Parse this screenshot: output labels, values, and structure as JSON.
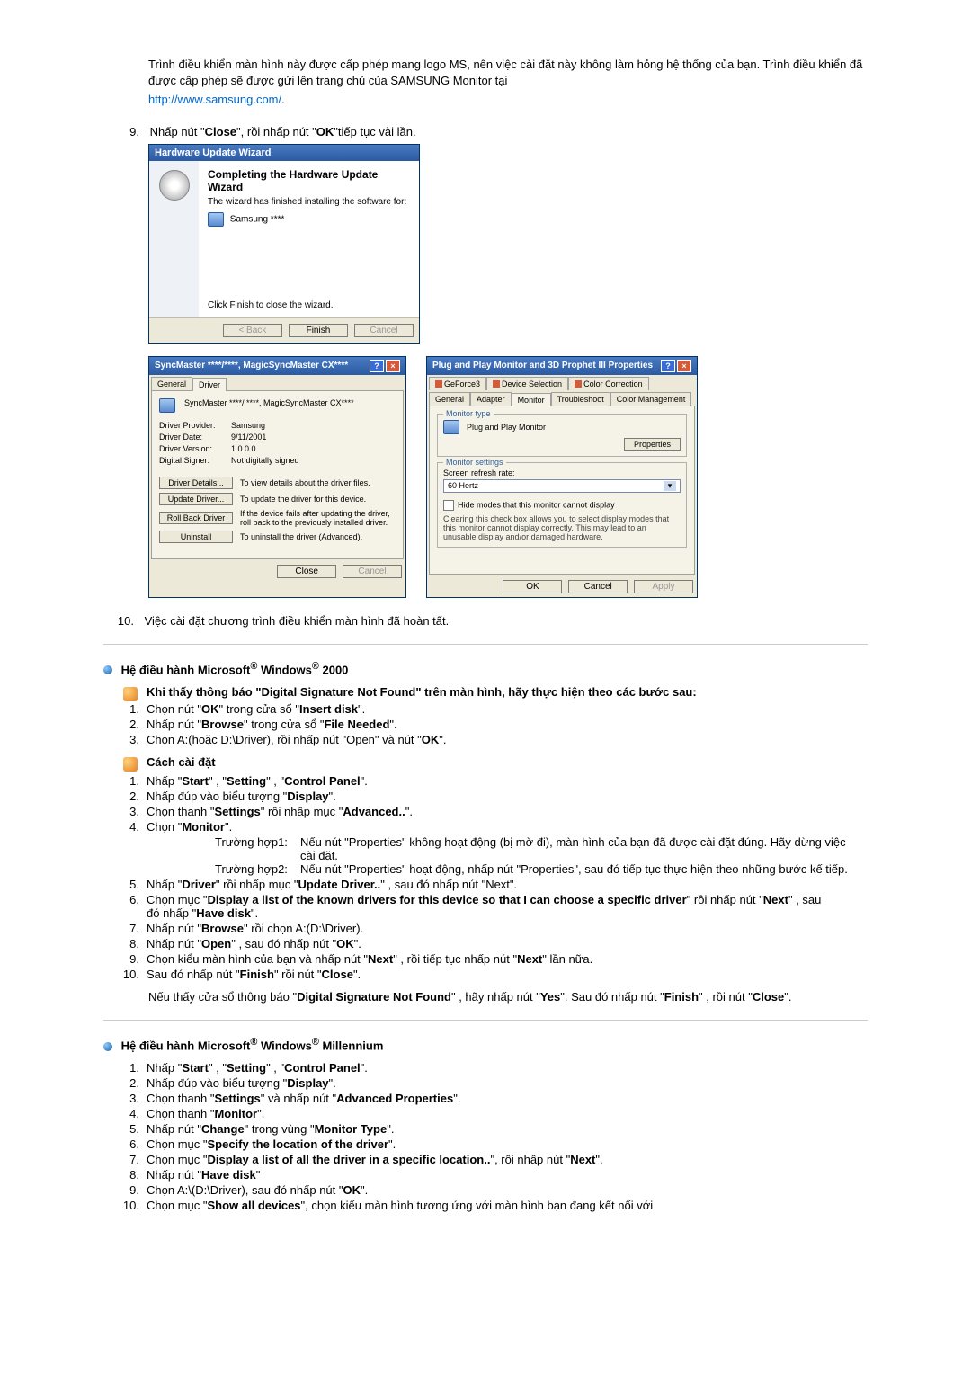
{
  "intro": {
    "p1": "Trình điều khiển màn hình này được cấp phép mang logo MS, nên việc cài đặt này không làm hỏng hệ thống của bạn. Trình điều khiển đã được cấp phép sẽ được gửi lên trang chủ của SAMSUNG Monitor tại",
    "link": "http://www.samsung.com/",
    "link_suffix": "."
  },
  "step9": {
    "num": "9.",
    "text_a": "Nhấp nút \"",
    "close": "Close",
    "text_b": "\", rồi nhấp nút \"",
    "ok": "OK",
    "text_c": "\"tiếp tục vài lần."
  },
  "wizard": {
    "title": "Hardware Update Wizard",
    "heading": "Completing the Hardware Update Wizard",
    "line1": "The wizard has finished installing the software for:",
    "device": "Samsung ****",
    "line2": "Click Finish to close the wizard.",
    "back": "< Back",
    "finish": "Finish",
    "cancel": "Cancel"
  },
  "driverprops": {
    "title": "SyncMaster ****/****, MagicSyncMaster CX****",
    "tab_general": "General",
    "tab_driver": "Driver",
    "device_name": "SyncMaster ****/ ****, MagicSyncMaster CX****",
    "provider_lbl": "Driver Provider:",
    "provider_val": "Samsung",
    "date_lbl": "Driver Date:",
    "date_val": "9/11/2001",
    "ver_lbl": "Driver Version:",
    "ver_val": "1.0.0.0",
    "signer_lbl": "Digital Signer:",
    "signer_val": "Not digitally signed",
    "btn_details": "Driver Details...",
    "desc_details": "To view details about the driver files.",
    "btn_update": "Update Driver...",
    "desc_update": "To update the driver for this device.",
    "btn_rollback": "Roll Back Driver",
    "desc_rollback": "If the device fails after updating the driver, roll back to the previously installed driver.",
    "btn_uninstall": "Uninstall",
    "desc_uninstall": "To uninstall the driver (Advanced).",
    "close": "Close",
    "cancel": "Cancel"
  },
  "dispprops": {
    "title": "Plug and Play Monitor and 3D Prophet III Properties",
    "t_geforce": "GeForce3",
    "t_devsel": "Device Selection",
    "t_colorcorr": "Color Correction",
    "t_general": "General",
    "t_adapter": "Adapter",
    "t_monitor": "Monitor",
    "t_trouble": "Troubleshoot",
    "t_colormgmt": "Color Management",
    "grp_montype": "Monitor type",
    "montype": "Plug and Play Monitor",
    "btn_props": "Properties",
    "grp_monset": "Monitor settings",
    "refresh_lbl": "Screen refresh rate:",
    "refresh_val": "60 Hertz",
    "hide_lbl": "Hide modes that this monitor cannot display",
    "hide_desc": "Clearing this check box allows you to select display modes that this monitor cannot display correctly. This may lead to an unusable display and/or damaged hardware.",
    "ok": "OK",
    "cancel": "Cancel",
    "apply": "Apply"
  },
  "step10": {
    "num": "10.",
    "text": "Việc cài đặt chương trình điều khiển màn hình đã hoàn tất."
  },
  "win2000": {
    "heading_a": "Hệ điều hành Microsoft",
    "heading_b": " Windows",
    "heading_c": " 2000",
    "sig_heading": "Khi thấy thông báo \"Digital Signature Not Found\" trên màn hình, hãy thực hiện theo các bước sau:",
    "s1": {
      "n": "1.",
      "a": "Chọn nút \"",
      "b": "OK",
      "c": "\" trong cửa sổ \"",
      "d": "Insert disk",
      "e": "\"."
    },
    "s2": {
      "n": "2.",
      "a": "Nhấp nút \"",
      "b": "Browse",
      "c": "\" trong cửa sổ \"",
      "d": "File Needed",
      "e": "\"."
    },
    "s3": {
      "n": "3.",
      "a": "Chọn A:(hoặc D:\\Driver), rồi nhấp nút \"Open\" và nút \"",
      "b": "OK",
      "c": "\"."
    },
    "inst_heading": "Cách cài đặt",
    "i1": {
      "n": "1.",
      "a": "Nhấp \"",
      "b": "Start",
      "c": "\" , \"",
      "d": "Setting",
      "e": "\" , \"",
      "f": "Control Panel",
      "g": "\"."
    },
    "i2": {
      "n": "2.",
      "a": "Nhấp đúp vào biểu tượng \"",
      "b": "Display",
      "c": "\"."
    },
    "i3": {
      "n": "3.",
      "a": "Chọn thanh \"",
      "b": "Settings",
      "c": "\" rồi nhấp mục \"",
      "d": "Advanced..",
      "e": "\"."
    },
    "i4": {
      "n": "4.",
      "a": "Chọn \"",
      "b": "Monitor",
      "c": "\"."
    },
    "i4c1": {
      "lbl": "Trường hợp1:",
      "txt": "Nếu nút \"Properties\" không hoạt động (bị mờ đi), màn hình của bạn đã được cài đặt đúng. Hãy dừng việc cài đặt."
    },
    "i4c2": {
      "lbl": "Trường hợp2:",
      "txt": "Nếu nút \"Properties\" hoạt động, nhấp nút \"Properties\", sau đó tiếp tục thực hiện theo những bước kế tiếp."
    },
    "i5": {
      "n": "5.",
      "a": "Nhấp \"",
      "b": "Driver",
      "c": "\" rồi nhấp mục \"",
      "d": "Update Driver..",
      "e": "\" , sau đó nhấp nút \"Next\"."
    },
    "i6": {
      "n": "6.",
      "a": "Chọn mục \"",
      "b": "Display a list of the known drivers for this device so that I can choose a specific driver",
      "c": "\" rồi nhấp nút \"",
      "d": "Next",
      "e": "\" , sau đó nhấp \"",
      "f": "Have disk",
      "g": "\"."
    },
    "i7": {
      "n": "7.",
      "a": "Nhấp nút \"",
      "b": "Browse",
      "c": "\" rồi chọn A:(D:\\Driver)."
    },
    "i8": {
      "n": "8.",
      "a": "Nhấp nút \"",
      "b": "Open",
      "c": "\" , sau đó nhấp nút \"",
      "d": "OK",
      "e": "\"."
    },
    "i9": {
      "n": "9.",
      "a": "Chọn kiểu màn hình của bạn và nhấp nút \"",
      "b": "Next",
      "c": "\" , rồi tiếp tục nhấp nút \"",
      "d": "Next",
      "e": "\" lần nữa."
    },
    "i10": {
      "n": "10.",
      "a": "Sau đó nhấp nút \"",
      "b": "Finish",
      "c": "\" rồi nút \"",
      "d": "Close",
      "e": "\"."
    },
    "note": {
      "a": "Nếu thấy cửa sổ thông báo \"",
      "b": "Digital Signature Not Found",
      "c": "\" , hãy nhấp nút \"",
      "d": "Yes",
      "e": "\". Sau đó nhấp nút \"",
      "f": "Finish",
      "g": "\" , rồi nút \"",
      "h": "Close",
      "i": "\"."
    }
  },
  "winme": {
    "heading_a": "Hệ điều hành Microsoft",
    "heading_b": " Windows",
    "heading_c": " Millennium",
    "i1": {
      "n": "1.",
      "a": "Nhấp \"",
      "b": "Start",
      "c": "\" , \"",
      "d": "Setting",
      "e": "\" , \"",
      "f": "Control Panel",
      "g": "\"."
    },
    "i2": {
      "n": "2.",
      "a": "Nhấp đúp vào biểu tượng \"",
      "b": "Display",
      "c": "\"."
    },
    "i3": {
      "n": "3.",
      "a": "Chọn thanh \"",
      "b": "Settings",
      "c": "\" và nhấp nút \"",
      "d": "Advanced Properties",
      "e": "\"."
    },
    "i4": {
      "n": "4.",
      "a": "Chọn thanh \"",
      "b": "Monitor",
      "c": "\"."
    },
    "i5": {
      "n": "5.",
      "a": "Nhấp nút \"",
      "b": "Change",
      "c": "\" trong vùng \"",
      "d": "Monitor Type",
      "e": "\"."
    },
    "i6": {
      "n": "6.",
      "a": "Chọn mục \"",
      "b": "Specify the location of the driver",
      "c": "\"."
    },
    "i7": {
      "n": "7.",
      "a": "Chọn mục \"",
      "b": "Display a list of all the driver in a specific location..",
      "c": "\", rồi nhấp nút \"",
      "d": "Next",
      "e": "\"."
    },
    "i8": {
      "n": "8.",
      "a": "Nhấp nút \"",
      "b": "Have disk",
      "c": "\""
    },
    "i9": {
      "n": "9.",
      "a": "Chọn A:\\(D:\\Driver), sau đó nhấp nút \"",
      "b": "OK",
      "c": "\"."
    },
    "i10": {
      "n": "10.",
      "a": "Chọn mục \"",
      "b": "Show all devices",
      "c": "\", chọn kiểu màn hình tương ứng với màn hình bạn đang kết nối với"
    }
  }
}
